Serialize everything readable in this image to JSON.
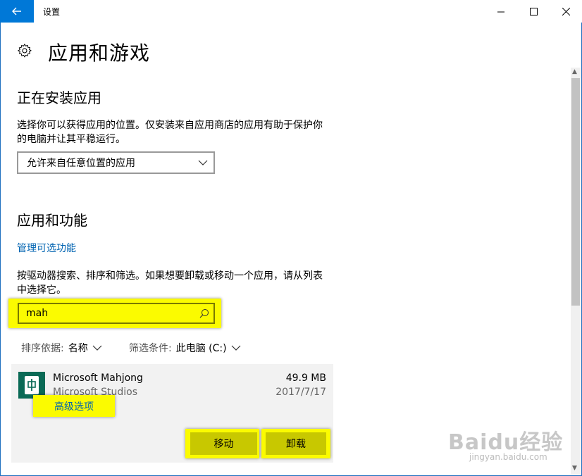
{
  "window": {
    "title": "设置"
  },
  "header": {
    "title": "应用和游戏",
    "icon": "gear-icon"
  },
  "install_section": {
    "heading": "正在安装应用",
    "description": "选择你可以获得应用的位置。仅安装来自应用商店的应用有助于保护你的电脑并让其平稳运行。",
    "dropdown_value": "允许来自任意位置的应用"
  },
  "apps_section": {
    "heading": "应用和功能",
    "manage_link": "管理可选功能",
    "description": "按驱动器搜索、排序和筛选。如果想要卸载或移动一个应用，请从列表中选择它。",
    "search_value": "mah",
    "sort_label": "排序依据:",
    "sort_value": "名称",
    "filter_label": "筛选条件:",
    "filter_value": "此电脑 (C:)"
  },
  "app_item": {
    "name": "Microsoft Mahjong",
    "publisher": "Microsoft Studios",
    "size": "49.9 MB",
    "date": "2017/7/17",
    "advanced_options": "高级选项",
    "move_button": "移动",
    "uninstall_button": "卸载"
  },
  "watermark": {
    "text": "Baidu经验",
    "sub": "jingyan.baidu.com"
  },
  "colors": {
    "accent": "#0078d7",
    "link": "#0063b1",
    "highlight": "#fbfb00"
  }
}
